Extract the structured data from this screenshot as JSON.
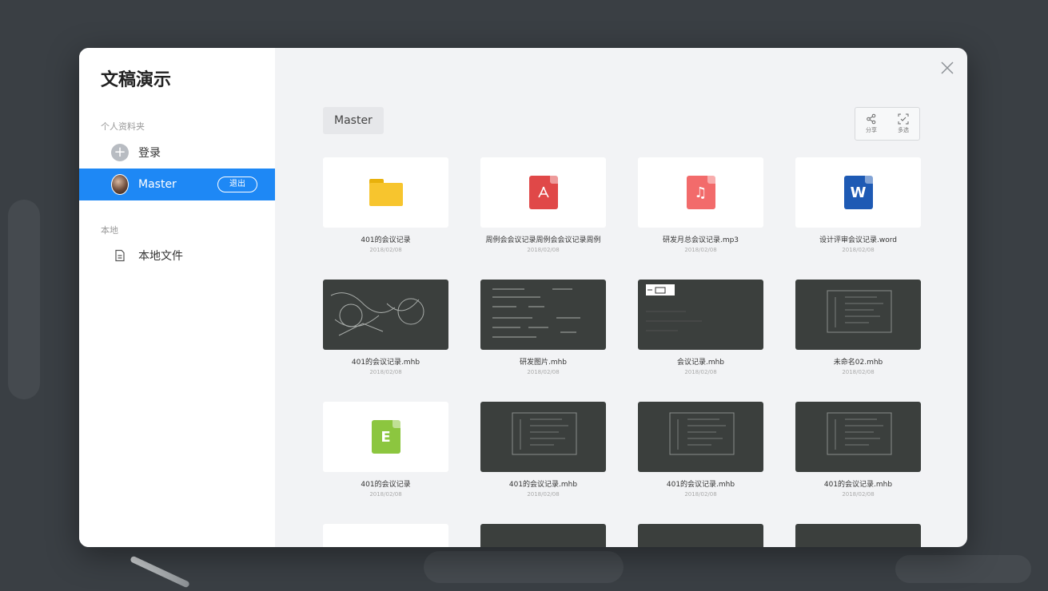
{
  "dialog": {
    "title": "文稿演示",
    "sections": {
      "personal": "个人资料夹",
      "local": "本地"
    },
    "login_label": "登录",
    "user_name": "Master",
    "logout_label": "退出",
    "local_files_label": "本地文件"
  },
  "main": {
    "breadcrumb": "Master",
    "toolbar": {
      "share_label": "分享",
      "multiselect_label": "多选"
    }
  },
  "colors": {
    "accent": "#1e88f5",
    "pdf": "#e04848",
    "mp3": "#f26b6b",
    "word": "#1e5ab4",
    "excel": "#8cc63f",
    "folder": "#f7c52e"
  },
  "files": [
    {
      "name": "401的会议记录",
      "date": "2018/02/08",
      "type": "folder"
    },
    {
      "name": "周例会会议记录周例会会议记录周例",
      "date": "2018/02/08",
      "type": "pdf"
    },
    {
      "name": "研发月总会议记录.mp3",
      "date": "2018/02/08",
      "type": "mp3"
    },
    {
      "name": "设计评审会议记录.word",
      "date": "2018/02/08",
      "type": "word"
    },
    {
      "name": "401的会议记录.mhb",
      "date": "2018/02/08",
      "type": "whiteboard"
    },
    {
      "name": "研发图片.mhb",
      "date": "2018/02/08",
      "type": "whiteboard"
    },
    {
      "name": "会议记录.mhb",
      "date": "2018/02/08",
      "type": "whiteboard"
    },
    {
      "name": "未命名02.mhb",
      "date": "2018/02/08",
      "type": "whiteboard"
    },
    {
      "name": "401的会议记录",
      "date": "2018/02/08",
      "type": "excel"
    },
    {
      "name": "401的会议记录.mhb",
      "date": "2018/02/08",
      "type": "whiteboard"
    },
    {
      "name": "401的会议记录.mhb",
      "date": "2018/02/08",
      "type": "whiteboard"
    },
    {
      "name": "401的会议记录.mhb",
      "date": "2018/02/08",
      "type": "whiteboard"
    }
  ]
}
